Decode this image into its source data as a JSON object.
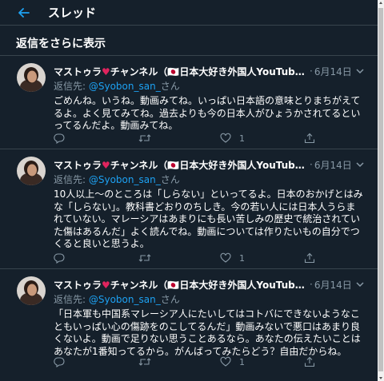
{
  "header": {
    "title": "スレッド",
    "back_icon": "arrow-left-icon"
  },
  "more_replies": "返信をさらに表示",
  "colors": {
    "background": "#15202b",
    "accent": "#1da1f2",
    "muted": "#8899a6",
    "divider": "#38444d",
    "heart": "#e0245e"
  },
  "tweets": [
    {
      "name": "マストゥラ♥チャンネル（🇯🇵日本大好き外国人YouTube...",
      "dot": "·",
      "date": "6月14日",
      "reply_prefix": "返信先: ",
      "reply_handle": "@Syobon_san_",
      "reply_suffix": "さん",
      "text": "ごめんね。いうね。動画みてね。いっぱい日本語の意味とりまちがえてるよ。よく見てみてね。過去よりも今の日本人がひょうかされてるといってるんだよ。動画みてね。",
      "like_count": "1"
    },
    {
      "name": "マストゥラ♥チャンネル（🇯🇵日本大好き外国人YouTube...",
      "dot": "·",
      "date": "6月14日",
      "reply_prefix": "返信先: ",
      "reply_handle": "@Syobon_san_",
      "reply_suffix": "さん",
      "text": "10人以上〜のところは「しらない」といってるよ。日本のおかげとはみな「しらない」。教科書どおりのちしき。今の若い人には日本人うらまれていない。マレーシアはあまりにも長い苦しみの歴史で統治されていた傷はあるんだ」よく読んでね。動画については作りたいもの自分でつくると良いと思うよ。",
      "like_count": "1"
    },
    {
      "name": "マストゥラ♥チャンネル（🇯🇵日本大好き外国人YouTube...",
      "dot": "·",
      "date": "6月14日",
      "reply_prefix": "返信先: ",
      "reply_handle": "@Syobon_san_",
      "reply_suffix": "さん",
      "text": "「日本軍も中国系マレーシア人にたいしてはコトバにできないようなこともいっぱい心の傷跡をのこしてるんだ」動画みないで悪口はあまり良くないよ。動画で足りない思うことあるなら。あなたの伝えたいことはあなたが1番知ってるから。がんばってみたらどう？自由だからね。",
      "like_count": "1"
    }
  ]
}
